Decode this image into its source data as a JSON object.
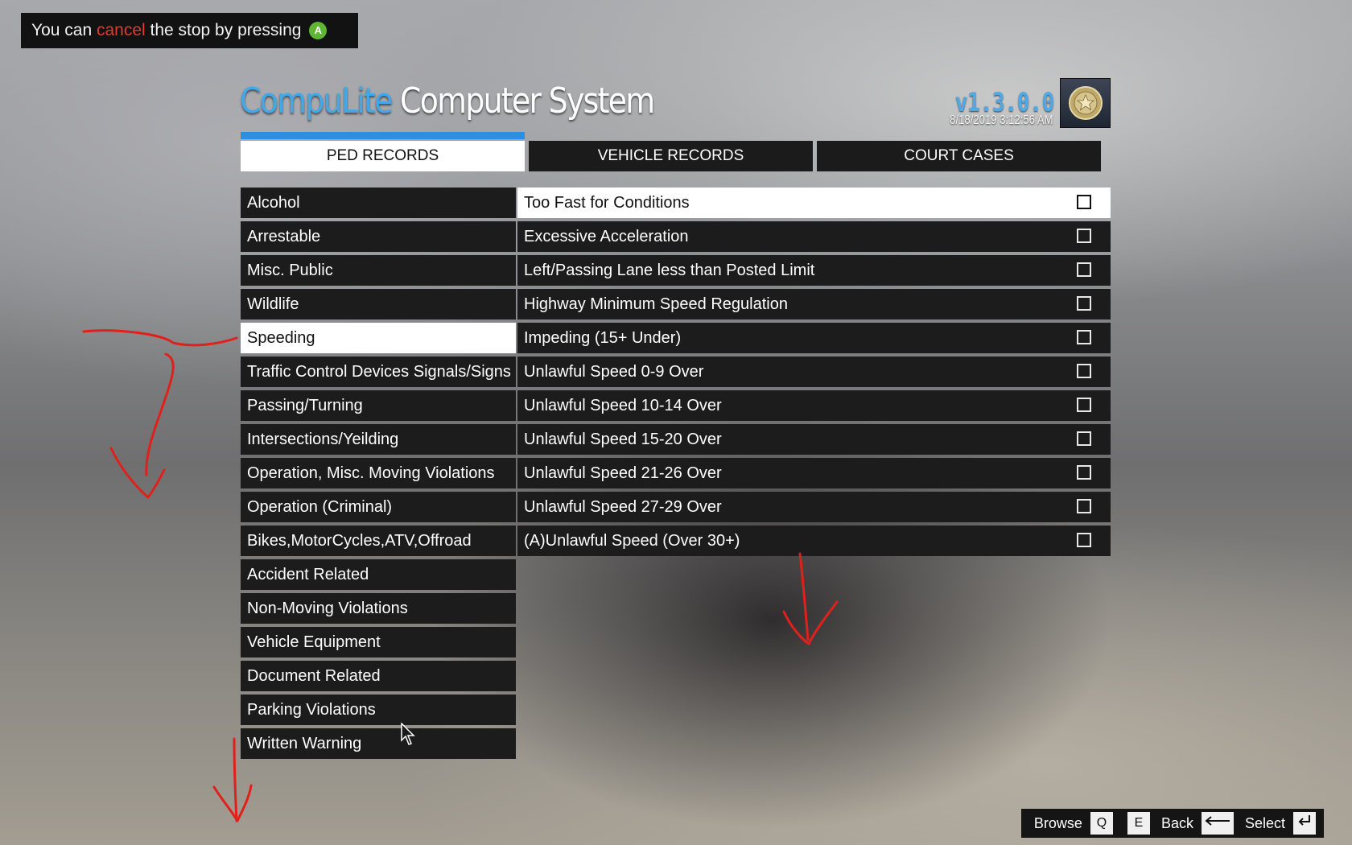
{
  "notification": {
    "prefix": "You can ",
    "highlight": "cancel",
    "suffix": " the stop by pressing",
    "button_key": "A",
    "colors": {
      "highlight": "#e03a2e",
      "button": "#5fb534"
    }
  },
  "header": {
    "brand_part1": "CompuLite",
    "brand_part2": "Computer System",
    "version": "v1.3.0.0",
    "datetime": "8/18/2019 3:12:56 AM",
    "badge_icon": "police-badge-icon"
  },
  "tabs": [
    {
      "label": "PED RECORDS",
      "active": true
    },
    {
      "label": "VEHICLE RECORDS",
      "active": false
    },
    {
      "label": "COURT CASES",
      "active": false
    }
  ],
  "categories": [
    {
      "label": "Alcohol"
    },
    {
      "label": "Arrestable"
    },
    {
      "label": "Misc. Public"
    },
    {
      "label": "Wildlife"
    },
    {
      "label": "Speeding",
      "selected": true
    },
    {
      "label": "Traffic Control Devices Signals/Signs"
    },
    {
      "label": "Passing/Turning"
    },
    {
      "label": "Intersections/Yeilding"
    },
    {
      "label": "Operation, Misc. Moving Violations"
    },
    {
      "label": "Operation (Criminal)"
    },
    {
      "label": "Bikes,MotorCycles,ATV,Offroad"
    },
    {
      "label": "Accident Related"
    },
    {
      "label": "Non-Moving Violations"
    },
    {
      "label": "Vehicle Equipment"
    },
    {
      "label": "Document Related"
    },
    {
      "label": "Parking Violations"
    },
    {
      "label": "Written Warning"
    }
  ],
  "charges": [
    {
      "label": "Too Fast for Conditions",
      "checked": false,
      "highlighted": true
    },
    {
      "label": "Excessive Acceleration",
      "checked": false
    },
    {
      "label": "Left/Passing Lane less than Posted Limit",
      "checked": false
    },
    {
      "label": "Highway Minimum Speed Regulation",
      "checked": false
    },
    {
      "label": "Impeding (15+ Under)",
      "checked": false
    },
    {
      "label": "Unlawful Speed 0-9 Over",
      "checked": false
    },
    {
      "label": "Unlawful Speed 10-14 Over",
      "checked": false
    },
    {
      "label": "Unlawful Speed 15-20 Over",
      "checked": false
    },
    {
      "label": "Unlawful Speed 21-26 Over",
      "checked": false
    },
    {
      "label": "Unlawful Speed 27-29 Over",
      "checked": false
    },
    {
      "label": "(A)Unlawful Speed (Over 30+)",
      "checked": false
    }
  ],
  "footer": {
    "browse_label": "Browse",
    "browse_key1": "Q",
    "browse_key2": "E",
    "back_label": "Back",
    "back_key_icon": "backspace-arrow-icon",
    "select_label": "Select",
    "select_key_icon": "enter-return-icon"
  },
  "colors": {
    "accent": "#2d8fe3",
    "panel": "#1c1c1c",
    "highlight_row": "#ffffff",
    "annotation": "#e0201b"
  }
}
